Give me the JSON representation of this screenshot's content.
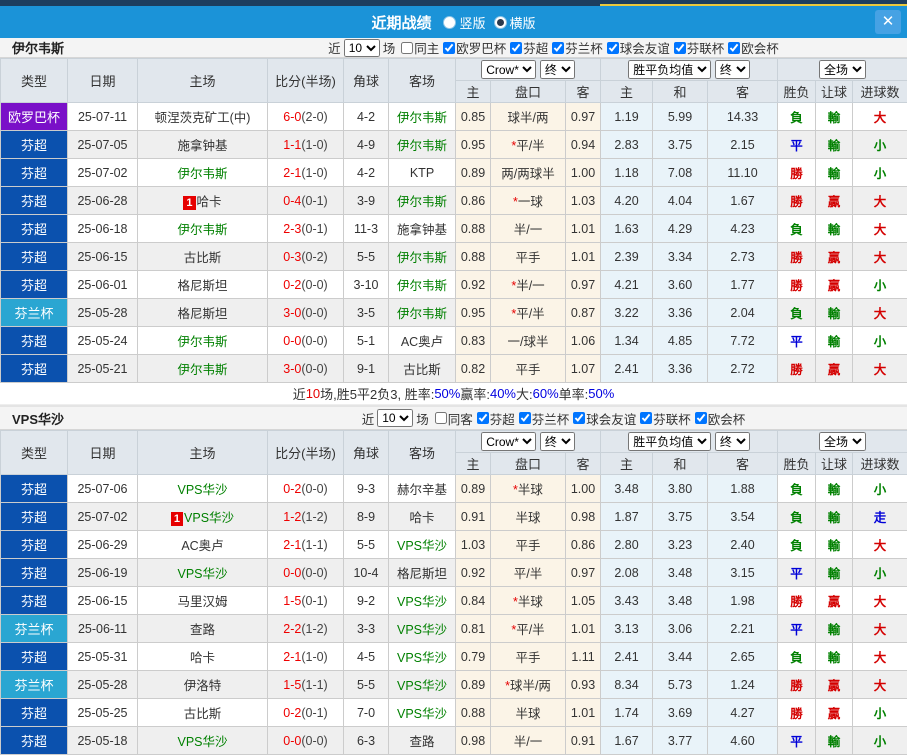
{
  "titlebar": {
    "title": "近期战绩",
    "layout_options": [
      {
        "label": "竖版",
        "selected": false
      },
      {
        "label": "横版",
        "selected": true
      }
    ],
    "close_label": "✕"
  },
  "filter": {
    "near_label": "近",
    "count": "10",
    "matches_label": "场"
  },
  "columns": [
    "类型",
    "日期",
    "主场",
    "比分(半场)",
    "角球",
    "客场"
  ],
  "odds_headers": {
    "group1_source": "Crow*",
    "group1_final": "终",
    "group2_source": "胜平负均值",
    "group2_final": "终",
    "group3_scope": "全场",
    "sub": [
      "主",
      "盘口",
      "客",
      "主",
      "和",
      "客",
      "胜负",
      "让球",
      "进球数"
    ]
  },
  "type_colors": {
    "欧罗巴杯": "#7a10c8",
    "芬超": "#0b51ae",
    "芬兰杯": "#2aa6d2"
  },
  "status_colors": {
    "red": "#d40000",
    "green": "#008000",
    "blue": "#0000d8"
  },
  "status_map": {
    "勝": "red",
    "贏": "red",
    "大": "red",
    "平": "blue",
    "走": "blue",
    "負": "green",
    "輸": "green",
    "小": "green"
  },
  "tables": [
    {
      "team": "伊尔韦斯",
      "same_label": "同主",
      "same_checked": false,
      "leagues": [
        {
          "label": "欧罗巴杯",
          "checked": true
        },
        {
          "label": "芬超",
          "checked": true
        },
        {
          "label": "芬兰杯",
          "checked": true
        },
        {
          "label": "球会友谊",
          "checked": true
        },
        {
          "label": "芬联杯",
          "checked": true
        },
        {
          "label": "欧会杯",
          "checked": true
        }
      ],
      "rows": [
        {
          "type": "欧罗巴杯",
          "date": "25-07-11",
          "home": "顿涅茨克矿工(中)",
          "home_subject": false,
          "home_badge": false,
          "score": "6-0",
          "half": "(2-0)",
          "corners": "4-2",
          "away": "伊尔韦斯",
          "away_subject": true,
          "h_odds": "0.85",
          "handicap": "球半/两",
          "handicap_star": false,
          "a_odds": "0.97",
          "avg_h": "1.19",
          "avg_d": "5.99",
          "avg_a": "14.33",
          "result": "負",
          "handicap_res": "輸",
          "goal_res": "大"
        },
        {
          "type": "芬超",
          "date": "25-07-05",
          "home": "施拿钟基",
          "home_subject": false,
          "home_badge": false,
          "score": "1-1",
          "half": "(1-0)",
          "corners": "4-9",
          "away": "伊尔韦斯",
          "away_subject": true,
          "h_odds": "0.95",
          "handicap": "平/半",
          "handicap_star": true,
          "a_odds": "0.94",
          "avg_h": "2.83",
          "avg_d": "3.75",
          "avg_a": "2.15",
          "result": "平",
          "handicap_res": "輸",
          "goal_res": "小"
        },
        {
          "type": "芬超",
          "date": "25-07-02",
          "home": "伊尔韦斯",
          "home_subject": true,
          "home_badge": false,
          "score": "2-1",
          "half": "(1-0)",
          "corners": "4-2",
          "away": "KTP",
          "away_subject": false,
          "h_odds": "0.89",
          "handicap": "两/两球半",
          "handicap_star": false,
          "a_odds": "1.00",
          "avg_h": "1.18",
          "avg_d": "7.08",
          "avg_a": "11.10",
          "result": "勝",
          "handicap_res": "輸",
          "goal_res": "小"
        },
        {
          "type": "芬超",
          "date": "25-06-28",
          "home": "哈卡",
          "home_subject": false,
          "home_badge": true,
          "score": "0-4",
          "half": "(0-1)",
          "corners": "3-9",
          "away": "伊尔韦斯",
          "away_subject": true,
          "h_odds": "0.86",
          "handicap": "一球",
          "handicap_star": true,
          "a_odds": "1.03",
          "avg_h": "4.20",
          "avg_d": "4.04",
          "avg_a": "1.67",
          "result": "勝",
          "handicap_res": "贏",
          "goal_res": "大"
        },
        {
          "type": "芬超",
          "date": "25-06-18",
          "home": "伊尔韦斯",
          "home_subject": true,
          "home_badge": false,
          "score": "2-3",
          "half": "(0-1)",
          "corners": "11-3",
          "away": "施拿钟基",
          "away_subject": false,
          "h_odds": "0.88",
          "handicap": "半/一",
          "handicap_star": false,
          "a_odds": "1.01",
          "avg_h": "1.63",
          "avg_d": "4.29",
          "avg_a": "4.23",
          "result": "負",
          "handicap_res": "輸",
          "goal_res": "大"
        },
        {
          "type": "芬超",
          "date": "25-06-15",
          "home": "古比斯",
          "home_subject": false,
          "home_badge": false,
          "score": "0-3",
          "half": "(0-2)",
          "corners": "5-5",
          "away": "伊尔韦斯",
          "away_subject": true,
          "h_odds": "0.88",
          "handicap": "平手",
          "handicap_star": false,
          "a_odds": "1.01",
          "avg_h": "2.39",
          "avg_d": "3.34",
          "avg_a": "2.73",
          "result": "勝",
          "handicap_res": "贏",
          "goal_res": "大"
        },
        {
          "type": "芬超",
          "date": "25-06-01",
          "home": "格尼斯坦",
          "home_subject": false,
          "home_badge": false,
          "score": "0-2",
          "half": "(0-0)",
          "corners": "3-10",
          "away": "伊尔韦斯",
          "away_subject": true,
          "h_odds": "0.92",
          "handicap": "半/一",
          "handicap_star": true,
          "a_odds": "0.97",
          "avg_h": "4.21",
          "avg_d": "3.60",
          "avg_a": "1.77",
          "result": "勝",
          "handicap_res": "贏",
          "goal_res": "小"
        },
        {
          "type": "芬兰杯",
          "date": "25-05-28",
          "home": "格尼斯坦",
          "home_subject": false,
          "home_badge": false,
          "score": "3-0",
          "half": "(0-0)",
          "corners": "3-5",
          "away": "伊尔韦斯",
          "away_subject": true,
          "h_odds": "0.95",
          "handicap": "平/半",
          "handicap_star": true,
          "a_odds": "0.87",
          "avg_h": "3.22",
          "avg_d": "3.36",
          "avg_a": "2.04",
          "result": "負",
          "handicap_res": "輸",
          "goal_res": "大"
        },
        {
          "type": "芬超",
          "date": "25-05-24",
          "home": "伊尔韦斯",
          "home_subject": true,
          "home_badge": false,
          "score": "0-0",
          "half": "(0-0)",
          "corners": "5-1",
          "away": "AC奥卢",
          "away_subject": false,
          "h_odds": "0.83",
          "handicap": "一/球半",
          "handicap_star": false,
          "a_odds": "1.06",
          "avg_h": "1.34",
          "avg_d": "4.85",
          "avg_a": "7.72",
          "result": "平",
          "handicap_res": "輸",
          "goal_res": "小"
        },
        {
          "type": "芬超",
          "date": "25-05-21",
          "home": "伊尔韦斯",
          "home_subject": true,
          "home_badge": false,
          "score": "3-0",
          "half": "(0-0)",
          "corners": "9-1",
          "away": "古比斯",
          "away_subject": false,
          "h_odds": "0.82",
          "handicap": "平手",
          "handicap_star": false,
          "a_odds": "1.07",
          "avg_h": "2.41",
          "avg_d": "3.36",
          "avg_a": "2.72",
          "result": "勝",
          "handicap_res": "贏",
          "goal_res": "大"
        }
      ],
      "summary_parts": [
        {
          "text": "近",
          "color": "#333333"
        },
        {
          "text": "10",
          "color": "#e60000"
        },
        {
          "text": "场,胜5平2负3, 胜率:",
          "color": "#333333"
        },
        {
          "text": "50%",
          "color": "#0000e0"
        },
        {
          "text": " 赢率:",
          "color": "#333333"
        },
        {
          "text": "40%",
          "color": "#0000e0"
        },
        {
          "text": " 大:",
          "color": "#333333"
        },
        {
          "text": "60%",
          "color": "#0000e0"
        },
        {
          "text": " 单率:",
          "color": "#333333"
        },
        {
          "text": "50%",
          "color": "#0000e0"
        }
      ]
    },
    {
      "team": "VPS华沙",
      "same_label": "同客",
      "same_checked": false,
      "leagues": [
        {
          "label": "芬超",
          "checked": true
        },
        {
          "label": "芬兰杯",
          "checked": true
        },
        {
          "label": "球会友谊",
          "checked": true
        },
        {
          "label": "芬联杯",
          "checked": true
        },
        {
          "label": "欧会杯",
          "checked": true
        }
      ],
      "rows": [
        {
          "type": "芬超",
          "date": "25-07-06",
          "home": "VPS华沙",
          "home_subject": true,
          "home_badge": false,
          "score": "0-2",
          "half": "(0-0)",
          "corners": "9-3",
          "away": "赫尔辛基",
          "away_subject": false,
          "h_odds": "0.89",
          "handicap": "半球",
          "handicap_star": true,
          "a_odds": "1.00",
          "avg_h": "3.48",
          "avg_d": "3.80",
          "avg_a": "1.88",
          "result": "負",
          "handicap_res": "輸",
          "goal_res": "小"
        },
        {
          "type": "芬超",
          "date": "25-07-02",
          "home": "VPS华沙",
          "home_subject": true,
          "home_badge": true,
          "score": "1-2",
          "half": "(1-2)",
          "corners": "8-9",
          "away": "哈卡",
          "away_subject": false,
          "h_odds": "0.91",
          "handicap": "半球",
          "handicap_star": false,
          "a_odds": "0.98",
          "avg_h": "1.87",
          "avg_d": "3.75",
          "avg_a": "3.54",
          "result": "負",
          "handicap_res": "輸",
          "goal_res": "走"
        },
        {
          "type": "芬超",
          "date": "25-06-29",
          "home": "AC奥卢",
          "home_subject": false,
          "home_badge": false,
          "score": "2-1",
          "half": "(1-1)",
          "corners": "5-5",
          "away": "VPS华沙",
          "away_subject": true,
          "h_odds": "1.03",
          "handicap": "平手",
          "handicap_star": false,
          "a_odds": "0.86",
          "avg_h": "2.80",
          "avg_d": "3.23",
          "avg_a": "2.40",
          "result": "負",
          "handicap_res": "輸",
          "goal_res": "大"
        },
        {
          "type": "芬超",
          "date": "25-06-19",
          "home": "VPS华沙",
          "home_subject": true,
          "home_badge": false,
          "score": "0-0",
          "half": "(0-0)",
          "corners": "10-4",
          "away": "格尼斯坦",
          "away_subject": false,
          "h_odds": "0.92",
          "handicap": "平/半",
          "handicap_star": false,
          "a_odds": "0.97",
          "avg_h": "2.08",
          "avg_d": "3.48",
          "avg_a": "3.15",
          "result": "平",
          "handicap_res": "輸",
          "goal_res": "小"
        },
        {
          "type": "芬超",
          "date": "25-06-15",
          "home": "马里汉姆",
          "home_subject": false,
          "home_badge": false,
          "score": "1-5",
          "half": "(0-1)",
          "corners": "9-2",
          "away": "VPS华沙",
          "away_subject": true,
          "h_odds": "0.84",
          "handicap": "半球",
          "handicap_star": true,
          "a_odds": "1.05",
          "avg_h": "3.43",
          "avg_d": "3.48",
          "avg_a": "1.98",
          "result": "勝",
          "handicap_res": "贏",
          "goal_res": "大"
        },
        {
          "type": "芬兰杯",
          "date": "25-06-11",
          "home": "查路",
          "home_subject": false,
          "home_badge": false,
          "score": "2-2",
          "half": "(1-2)",
          "corners": "3-3",
          "away": "VPS华沙",
          "away_subject": true,
          "h_odds": "0.81",
          "handicap": "平/半",
          "handicap_star": true,
          "a_odds": "1.01",
          "avg_h": "3.13",
          "avg_d": "3.06",
          "avg_a": "2.21",
          "result": "平",
          "handicap_res": "輸",
          "goal_res": "大"
        },
        {
          "type": "芬超",
          "date": "25-05-31",
          "home": "哈卡",
          "home_subject": false,
          "home_badge": false,
          "score": "2-1",
          "half": "(1-0)",
          "corners": "4-5",
          "away": "VPS华沙",
          "away_subject": true,
          "h_odds": "0.79",
          "handicap": "平手",
          "handicap_star": false,
          "a_odds": "1.11",
          "avg_h": "2.41",
          "avg_d": "3.44",
          "avg_a": "2.65",
          "result": "負",
          "handicap_res": "輸",
          "goal_res": "大"
        },
        {
          "type": "芬兰杯",
          "date": "25-05-28",
          "home": "伊洛特",
          "home_subject": false,
          "home_badge": false,
          "score": "1-5",
          "half": "(1-1)",
          "corners": "5-5",
          "away": "VPS华沙",
          "away_subject": true,
          "h_odds": "0.89",
          "handicap": "球半/两",
          "handicap_star": true,
          "a_odds": "0.93",
          "avg_h": "8.34",
          "avg_d": "5.73",
          "avg_a": "1.24",
          "result": "勝",
          "handicap_res": "贏",
          "goal_res": "大"
        },
        {
          "type": "芬超",
          "date": "25-05-25",
          "home": "古比斯",
          "home_subject": false,
          "home_badge": false,
          "score": "0-2",
          "half": "(0-1)",
          "corners": "7-0",
          "away": "VPS华沙",
          "away_subject": true,
          "h_odds": "0.88",
          "handicap": "半球",
          "handicap_star": false,
          "a_odds": "1.01",
          "avg_h": "1.74",
          "avg_d": "3.69",
          "avg_a": "4.27",
          "result": "勝",
          "handicap_res": "贏",
          "goal_res": "小"
        },
        {
          "type": "芬超",
          "date": "25-05-18",
          "home": "VPS华沙",
          "home_subject": true,
          "home_badge": false,
          "score": "0-0",
          "half": "(0-0)",
          "corners": "6-3",
          "away": "查路",
          "away_subject": false,
          "h_odds": "0.98",
          "handicap": "半/一",
          "handicap_star": false,
          "a_odds": "0.91",
          "avg_h": "1.67",
          "avg_d": "3.77",
          "avg_a": "4.60",
          "result": "平",
          "handicap_res": "輸",
          "goal_res": "小"
        }
      ],
      "summary_parts": []
    }
  ]
}
